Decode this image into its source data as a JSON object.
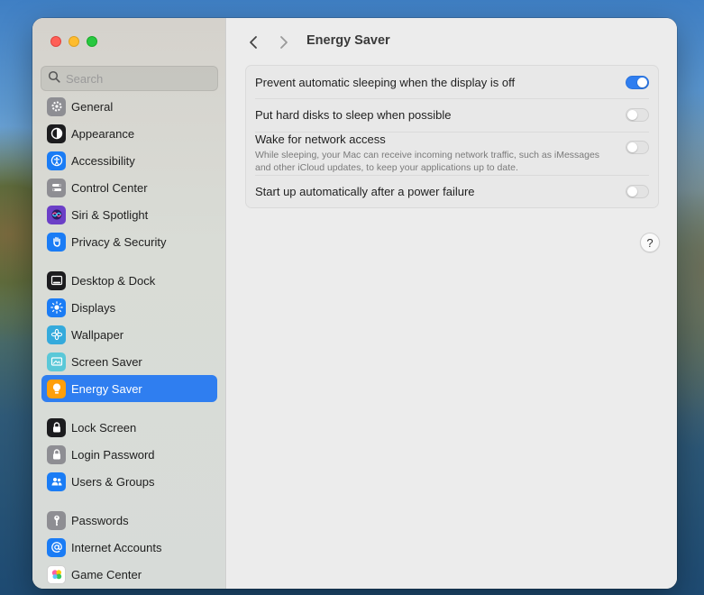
{
  "window": {
    "title": "Energy Saver"
  },
  "search": {
    "placeholder": "Search"
  },
  "sidebar": {
    "items": [
      {
        "label": "General",
        "icon": "gear-icon",
        "color": "#8e8e93",
        "active": false
      },
      {
        "label": "Appearance",
        "icon": "appearance-icon",
        "color": "#1c1c1e",
        "active": false
      },
      {
        "label": "Accessibility",
        "icon": "accessibility-icon",
        "color": "#1a7cf5",
        "active": false
      },
      {
        "label": "Control Center",
        "icon": "control-center-icon",
        "color": "#8e8e93",
        "active": false
      },
      {
        "label": "Siri & Spotlight",
        "icon": "siri-icon",
        "color": "#6b3fc7",
        "active": false
      },
      {
        "label": "Privacy & Security",
        "icon": "hand-icon",
        "color": "#1a7cf5",
        "active": false
      },
      {
        "label": "Desktop & Dock",
        "icon": "dock-icon",
        "color": "#1c1c1e",
        "active": false
      },
      {
        "label": "Displays",
        "icon": "sun-icon",
        "color": "#1a7cf5",
        "active": false
      },
      {
        "label": "Wallpaper",
        "icon": "flower-icon",
        "color": "#34aadc",
        "active": false
      },
      {
        "label": "Screen Saver",
        "icon": "screen-saver-icon",
        "color": "#5ac8d8",
        "active": false
      },
      {
        "label": "Energy Saver",
        "icon": "lightbulb-icon",
        "color": "#ff9f0a",
        "active": true
      },
      {
        "label": "Lock Screen",
        "icon": "lock-icon",
        "color": "#1c1c1e",
        "active": false
      },
      {
        "label": "Login Password",
        "icon": "lock-icon",
        "color": "#8e8e93",
        "active": false
      },
      {
        "label": "Users & Groups",
        "icon": "users-icon",
        "color": "#1a7cf5",
        "active": false
      },
      {
        "label": "Passwords",
        "icon": "key-icon",
        "color": "#8e8e93",
        "active": false
      },
      {
        "label": "Internet Accounts",
        "icon": "at-icon",
        "color": "#1a7cf5",
        "active": false
      },
      {
        "label": "Game Center",
        "icon": "game-center-icon",
        "color": "#ffffff",
        "active": false
      }
    ]
  },
  "settings": {
    "rows": [
      {
        "label": "Prevent automatic sleeping when the display is off",
        "description": "",
        "on": true
      },
      {
        "label": "Put hard disks to sleep when possible",
        "description": "",
        "on": false
      },
      {
        "label": "Wake for network access",
        "description": "While sleeping, your Mac can receive incoming network traffic, such as iMessages and other iCloud updates, to keep your applications up to date.",
        "on": false
      },
      {
        "label": "Start up automatically after a power failure",
        "description": "",
        "on": false
      }
    ]
  },
  "help": {
    "label": "?"
  }
}
